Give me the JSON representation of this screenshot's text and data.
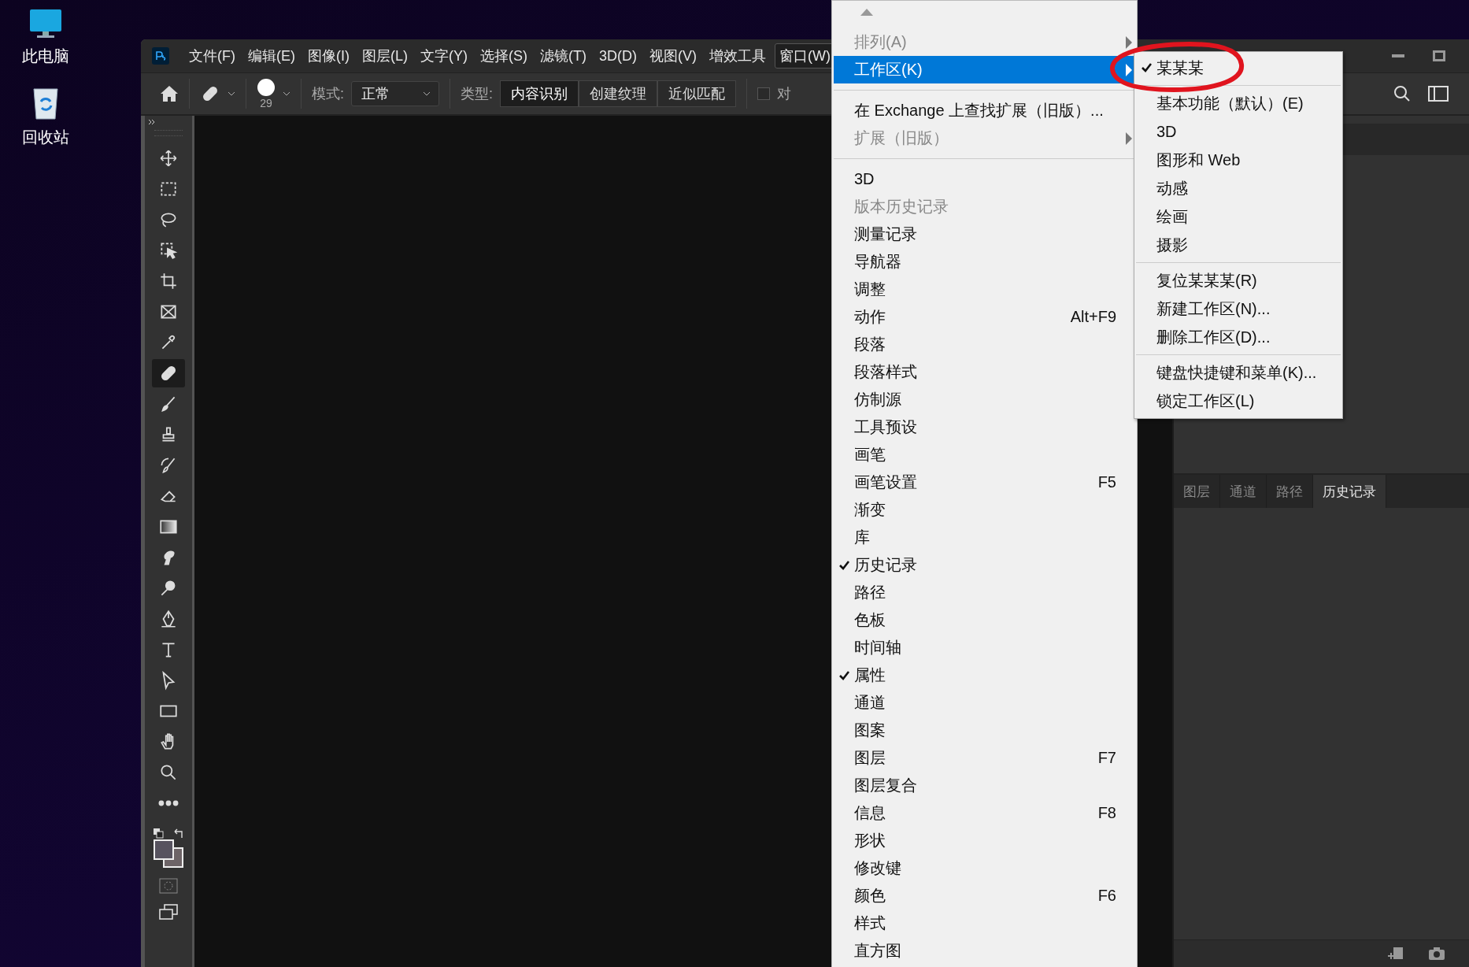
{
  "desktop_icons": [
    {
      "kind": "computer",
      "label": "此电脑"
    },
    {
      "kind": "recycle",
      "label": "回收站"
    }
  ],
  "menubar": [
    {
      "label": "文件(F)",
      "selected": false
    },
    {
      "label": "编辑(E)",
      "selected": false
    },
    {
      "label": "图像(I)",
      "selected": false
    },
    {
      "label": "图层(L)",
      "selected": false
    },
    {
      "label": "文字(Y)",
      "selected": false
    },
    {
      "label": "选择(S)",
      "selected": false
    },
    {
      "label": "滤镜(T)",
      "selected": false
    },
    {
      "label": "3D(D)",
      "selected": false
    },
    {
      "label": "视图(V)",
      "selected": false
    },
    {
      "label": "增效工具",
      "selected": false
    },
    {
      "label": "窗口(W)",
      "selected": true
    }
  ],
  "options_bar": {
    "brush_size": "29",
    "mode_label": "模式:",
    "mode_value": "正常",
    "type_label": "类型:",
    "type_options": [
      {
        "label": "内容识别",
        "selected": true
      },
      {
        "label": "创建纹理",
        "selected": false
      },
      {
        "label": "近似匹配",
        "selected": false
      }
    ],
    "align_checkbox": {
      "label": "对",
      "checked": false
    }
  },
  "tools": [
    {
      "kind": "move",
      "selected": false
    },
    {
      "kind": "marquee",
      "selected": false
    },
    {
      "kind": "lasso",
      "selected": false
    },
    {
      "kind": "object-select",
      "selected": false
    },
    {
      "kind": "crop",
      "selected": false
    },
    {
      "kind": "frame",
      "selected": false
    },
    {
      "kind": "eyedropper",
      "selected": false
    },
    {
      "kind": "bandage",
      "selected": true
    },
    {
      "kind": "brush",
      "selected": false
    },
    {
      "kind": "stamp",
      "selected": false
    },
    {
      "kind": "history-brush",
      "selected": false
    },
    {
      "kind": "eraser",
      "selected": false
    },
    {
      "kind": "gradient",
      "selected": false
    },
    {
      "kind": "smudge",
      "selected": false
    },
    {
      "kind": "dodge",
      "selected": false
    },
    {
      "kind": "pen",
      "selected": false
    },
    {
      "kind": "text",
      "selected": false
    },
    {
      "kind": "pointer",
      "selected": false
    },
    {
      "kind": "rectangle",
      "selected": false
    },
    {
      "kind": "hand",
      "selected": false
    },
    {
      "kind": "zoom",
      "selected": false
    },
    {
      "kind": "more",
      "selected": false
    }
  ],
  "panel_tabs": [
    {
      "label": "图层",
      "selected": false
    },
    {
      "label": "通道",
      "selected": false
    },
    {
      "label": "路径",
      "selected": false
    },
    {
      "label": "历史记录",
      "selected": true
    }
  ],
  "window_menu": [
    {
      "kind": "item",
      "label": "排列(A)",
      "selected": false,
      "disabled": true,
      "checked": false,
      "submenu": true
    },
    {
      "kind": "item",
      "label": "工作区(K)",
      "selected": true,
      "disabled": false,
      "checked": false,
      "submenu": true
    },
    {
      "kind": "separator"
    },
    {
      "kind": "item",
      "label": "在 Exchange 上查找扩展（旧版）...",
      "selected": false,
      "disabled": false,
      "checked": false,
      "submenu": false
    },
    {
      "kind": "item",
      "label": "扩展（旧版）",
      "selected": false,
      "disabled": true,
      "checked": false,
      "submenu": true
    },
    {
      "kind": "separator"
    },
    {
      "kind": "item",
      "label": "3D",
      "selected": false,
      "disabled": false,
      "checked": false,
      "submenu": false
    },
    {
      "kind": "item",
      "label": "版本历史记录",
      "selected": false,
      "disabled": true,
      "checked": false,
      "submenu": false
    },
    {
      "kind": "item",
      "label": "测量记录",
      "selected": false,
      "disabled": false,
      "checked": false,
      "submenu": false
    },
    {
      "kind": "item",
      "label": "导航器",
      "selected": false,
      "disabled": false,
      "checked": false,
      "submenu": false
    },
    {
      "kind": "item",
      "label": "调整",
      "selected": false,
      "disabled": false,
      "checked": false,
      "submenu": false
    },
    {
      "kind": "item",
      "label": "动作",
      "shortcut": "Alt+F9",
      "selected": false,
      "disabled": false,
      "checked": false,
      "submenu": false
    },
    {
      "kind": "item",
      "label": "段落",
      "selected": false,
      "disabled": false,
      "checked": false,
      "submenu": false
    },
    {
      "kind": "item",
      "label": "段落样式",
      "selected": false,
      "disabled": false,
      "checked": false,
      "submenu": false
    },
    {
      "kind": "item",
      "label": "仿制源",
      "selected": false,
      "disabled": false,
      "checked": false,
      "submenu": false
    },
    {
      "kind": "item",
      "label": "工具预设",
      "selected": false,
      "disabled": false,
      "checked": false,
      "submenu": false
    },
    {
      "kind": "item",
      "label": "画笔",
      "selected": false,
      "disabled": false,
      "checked": false,
      "submenu": false
    },
    {
      "kind": "item",
      "label": "画笔设置",
      "shortcut": "F5",
      "selected": false,
      "disabled": false,
      "checked": false,
      "submenu": false
    },
    {
      "kind": "item",
      "label": "渐变",
      "selected": false,
      "disabled": false,
      "checked": false,
      "submenu": false
    },
    {
      "kind": "item",
      "label": "库",
      "selected": false,
      "disabled": false,
      "checked": false,
      "submenu": false
    },
    {
      "kind": "item",
      "label": "历史记录",
      "selected": false,
      "disabled": false,
      "checked": true,
      "submenu": false
    },
    {
      "kind": "item",
      "label": "路径",
      "selected": false,
      "disabled": false,
      "checked": false,
      "submenu": false
    },
    {
      "kind": "item",
      "label": "色板",
      "selected": false,
      "disabled": false,
      "checked": false,
      "submenu": false
    },
    {
      "kind": "item",
      "label": "时间轴",
      "selected": false,
      "disabled": false,
      "checked": false,
      "submenu": false
    },
    {
      "kind": "item",
      "label": "属性",
      "selected": false,
      "disabled": false,
      "checked": true,
      "submenu": false
    },
    {
      "kind": "item",
      "label": "通道",
      "selected": false,
      "disabled": false,
      "checked": false,
      "submenu": false
    },
    {
      "kind": "item",
      "label": "图案",
      "selected": false,
      "disabled": false,
      "checked": false,
      "submenu": false
    },
    {
      "kind": "item",
      "label": "图层",
      "shortcut": "F7",
      "selected": false,
      "disabled": false,
      "checked": false,
      "submenu": false
    },
    {
      "kind": "item",
      "label": "图层复合",
      "selected": false,
      "disabled": false,
      "checked": false,
      "submenu": false
    },
    {
      "kind": "item",
      "label": "信息",
      "shortcut": "F8",
      "selected": false,
      "disabled": false,
      "checked": false,
      "submenu": false
    },
    {
      "kind": "item",
      "label": "形状",
      "selected": false,
      "disabled": false,
      "checked": false,
      "submenu": false
    },
    {
      "kind": "item",
      "label": "修改键",
      "selected": false,
      "disabled": false,
      "checked": false,
      "submenu": false
    },
    {
      "kind": "item",
      "label": "颜色",
      "shortcut": "F6",
      "selected": false,
      "disabled": false,
      "checked": false,
      "submenu": false
    },
    {
      "kind": "item",
      "label": "样式",
      "selected": false,
      "disabled": false,
      "checked": false,
      "submenu": false
    },
    {
      "kind": "item",
      "label": "直方图",
      "selected": false,
      "disabled": false,
      "checked": false,
      "submenu": false
    }
  ],
  "workspace_submenu": [
    {
      "kind": "item",
      "label": "某某某",
      "checked": true
    },
    {
      "kind": "separator"
    },
    {
      "kind": "item",
      "label": "基本功能（默认）(E)",
      "checked": false
    },
    {
      "kind": "item",
      "label": "3D",
      "checked": false
    },
    {
      "kind": "item",
      "label": "图形和 Web",
      "checked": false
    },
    {
      "kind": "item",
      "label": "动感",
      "checked": false
    },
    {
      "kind": "item",
      "label": "绘画",
      "checked": false
    },
    {
      "kind": "item",
      "label": "摄影",
      "checked": false
    },
    {
      "kind": "separator"
    },
    {
      "kind": "item",
      "label": "复位某某某(R)",
      "checked": false
    },
    {
      "kind": "item",
      "label": "新建工作区(N)...",
      "checked": false
    },
    {
      "kind": "item",
      "label": "删除工作区(D)...",
      "checked": false
    },
    {
      "kind": "separator"
    },
    {
      "kind": "item",
      "label": "键盘快捷键和菜单(K)...",
      "checked": false
    },
    {
      "kind": "item",
      "label": "锁定工作区(L)",
      "checked": false
    }
  ]
}
